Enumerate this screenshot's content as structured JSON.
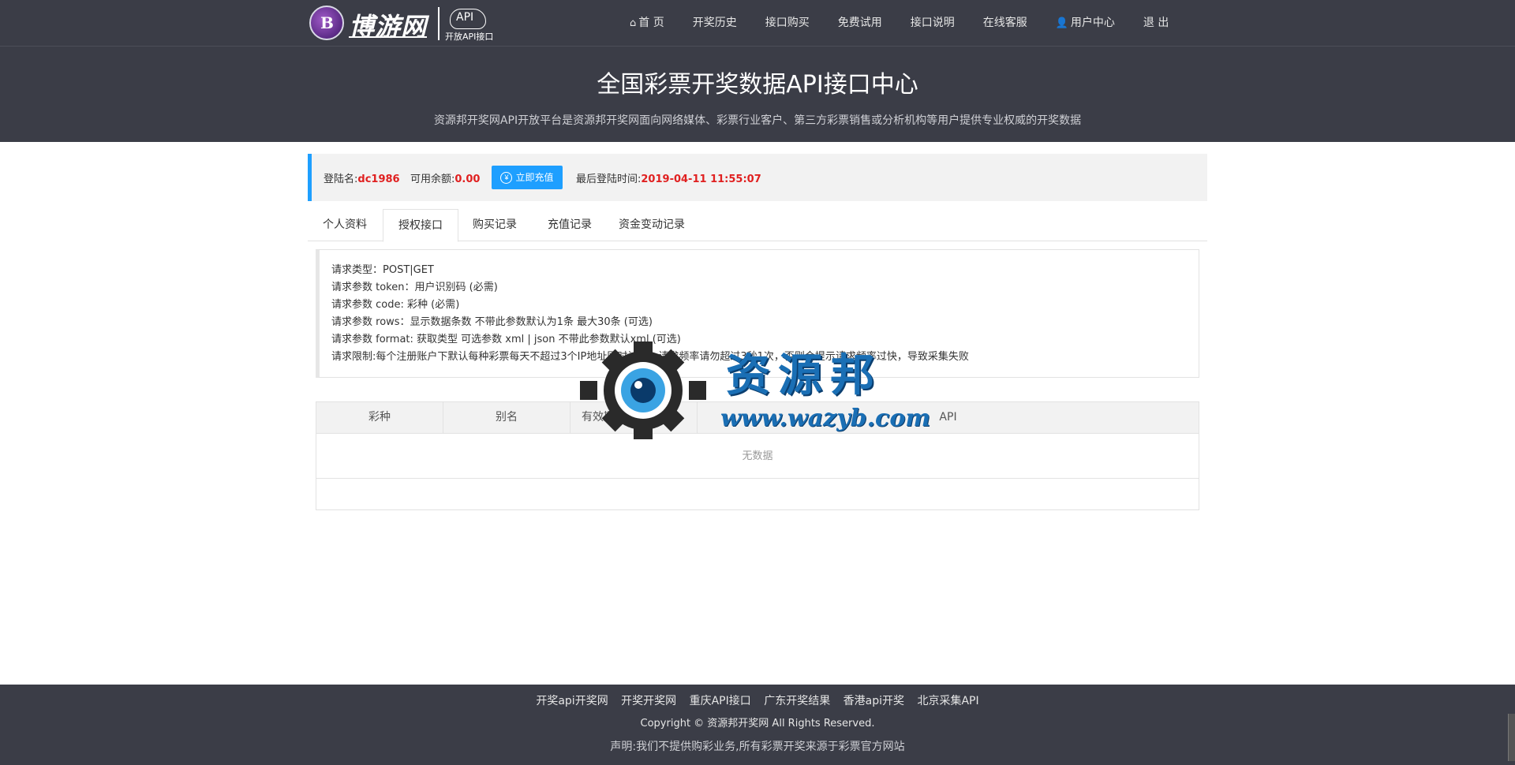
{
  "header": {
    "logo": {
      "badge": "B",
      "name": "博游网",
      "cloud": "API",
      "sub": "开放API接口"
    },
    "menu": [
      {
        "icon": "home-icon",
        "label": "首 页"
      },
      {
        "label": "开奖历史"
      },
      {
        "label": "接口购买"
      },
      {
        "label": "免费试用"
      },
      {
        "label": "接口说明"
      },
      {
        "label": "在线客服"
      },
      {
        "icon": "user-icon",
        "label": "用户中心"
      },
      {
        "label": "退 出"
      }
    ],
    "title": "全国彩票开奖数据API接口中心",
    "subtitle": "资源邦开奖网API开放平台是资源邦开奖网面向网络媒体、彩票行业客户、第三方彩票销售或分析机构等用户提供专业权威的开奖数据"
  },
  "userbar": {
    "login_label": "登陆名:",
    "login_value": "dc1986",
    "balance_label": "可用余额:",
    "balance_value": "0.00",
    "recharge_label": "立即充值",
    "last_login_label": "最后登陆时间:",
    "last_login_value": "2019-04-11 11:55:07"
  },
  "tabs": [
    "个人资料",
    "授权接口",
    "购买记录",
    "充值记录",
    "资金变动记录"
  ],
  "active_tab": "授权接口",
  "info_lines": [
    "请求类型：POST|GET",
    "请求参数 token：用户识别码 (必需)",
    "请求参数 code: 彩种 (必需)",
    "请求参数 rows：显示数据条数 不带此参数默认为1条 最大30条 (可选)",
    "请求参数 format: 获取类型 可选参数 xml | json 不带此参数默认xml (可选)",
    "请求限制:每个注册账户下默认每种彩票每天不超过3个IP地址同时访问，请求频率请勿超过3秒1次，否则会提示请求频率过快，导致采集失败"
  ],
  "table": {
    "columns": [
      "彩种",
      "别名",
      "有效期",
      "API"
    ],
    "empty_text": "无数据"
  },
  "watermark": {
    "cn": "资源邦",
    "url": "www.wazyb.com"
  },
  "footer": {
    "links": [
      "开奖api开奖网",
      "开奖开奖网",
      "重庆API接口",
      "广东开奖结果",
      "香港api开奖",
      "北京采集API"
    ],
    "copyright": "Copyright © 资源邦开奖网 All Rights Reserved.",
    "notice": "声明:我们不提供购彩业务,所有彩票开奖来源于彩票官方网站"
  },
  "colors": {
    "header_bg": "#3b3d47",
    "accent": "#1e9fff",
    "highlight": "#e02020"
  }
}
